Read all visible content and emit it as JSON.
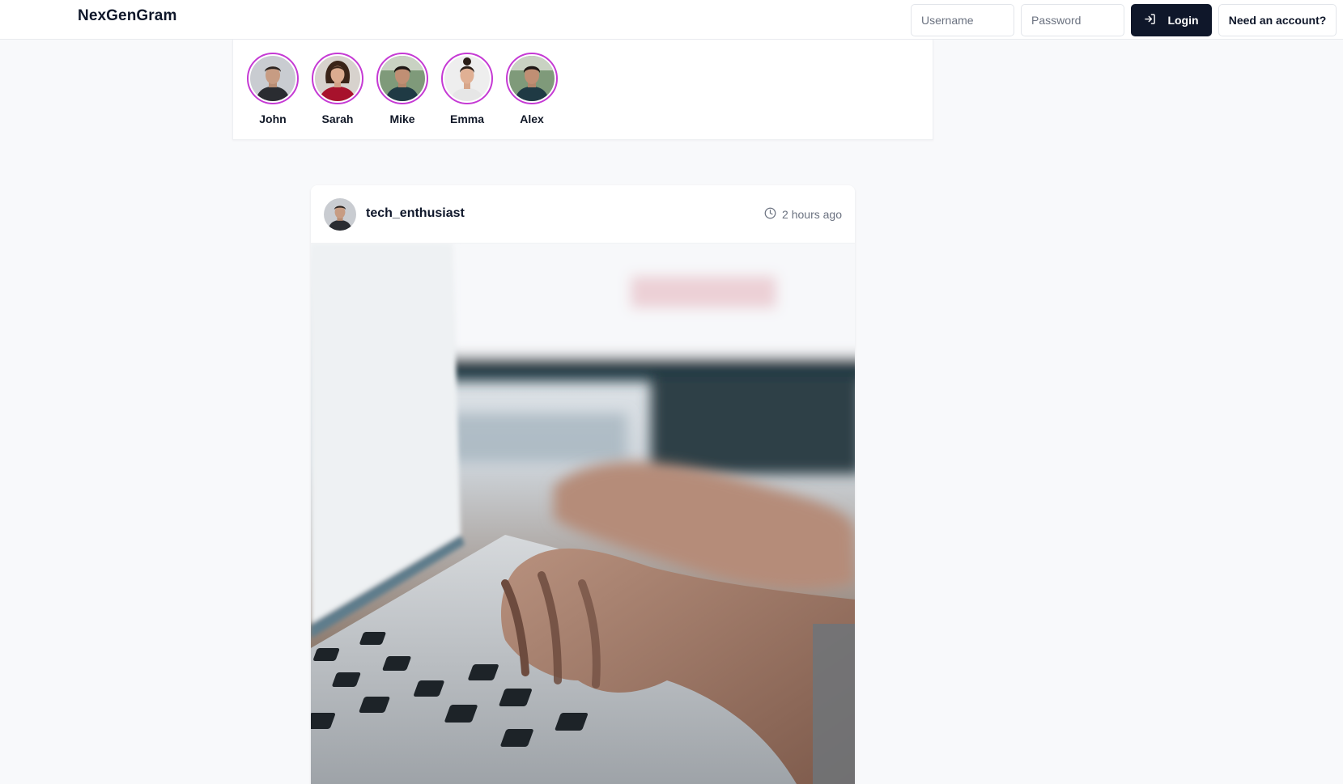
{
  "header": {
    "brand": "NexGenGram",
    "username_placeholder": "Username",
    "password_placeholder": "Password",
    "login_label": "Login",
    "register_label": "Need an account?"
  },
  "stories": [
    {
      "name": "John",
      "icon": "avatar-john"
    },
    {
      "name": "Sarah",
      "icon": "avatar-sarah"
    },
    {
      "name": "Mike",
      "icon": "avatar-mike"
    },
    {
      "name": "Emma",
      "icon": "avatar-emma"
    },
    {
      "name": "Alex",
      "icon": "avatar-alex"
    }
  ],
  "post": {
    "username": "tech_enthusiast",
    "time": "2 hours ago",
    "image": "laptop-typing-photo"
  },
  "colors": {
    "story_ring": "#c53ad4",
    "primary_button": "#0f172a",
    "page_background": "#f8f9fb"
  }
}
